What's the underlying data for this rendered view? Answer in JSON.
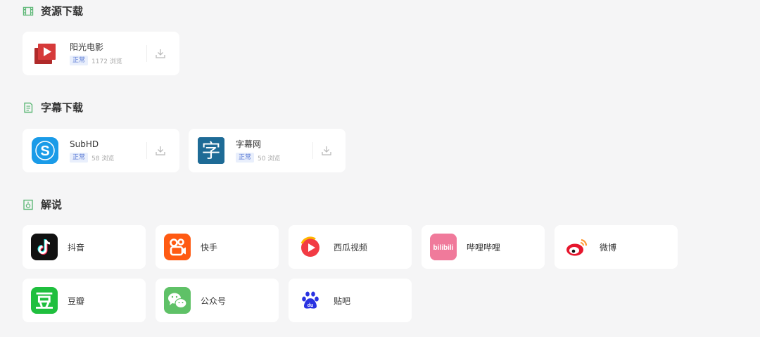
{
  "sections": [
    {
      "title": "资源下载",
      "items": [
        {
          "name": "阳光电影",
          "status": "正常",
          "views": "1172 浏览"
        }
      ]
    },
    {
      "title": "字幕下载",
      "items": [
        {
          "name": "SubHD",
          "status": "正常",
          "views": "58 浏览",
          "logo_text": "S"
        },
        {
          "name": "字幕网",
          "status": "正常",
          "views": "50 浏览",
          "logo_text": "字"
        }
      ]
    },
    {
      "title": "解说",
      "items": [
        {
          "name": "抖音"
        },
        {
          "name": "快手"
        },
        {
          "name": "西瓜视频"
        },
        {
          "name": "哔哩哔哩",
          "logo_text": "bilibili"
        },
        {
          "name": "微博"
        },
        {
          "name": "豆瓣",
          "logo_text": "豆"
        },
        {
          "name": "公众号"
        },
        {
          "name": "贴吧",
          "logo_text": "du"
        }
      ]
    }
  ],
  "colors": {
    "section_icon": "#5fb878",
    "badge_text": "#5b7bd5",
    "badge_bg": "#e9effc",
    "sunshine": "#d63a3a",
    "subhd": "#1a9be8",
    "zimu": "#1e6b96",
    "douyin": "#111111",
    "kuaishou": "#ff5a12",
    "xigua": "#ffffff",
    "bilibili": "#f07a9b",
    "weibo": "#e6162d",
    "douban": "#2bc653",
    "wechat": "#5fc167",
    "tieba": "#2932e1"
  },
  "icons": {
    "section_1": "film-icon",
    "section_2": "document-icon",
    "section_3": "speaker-icon",
    "download": "download-icon"
  }
}
